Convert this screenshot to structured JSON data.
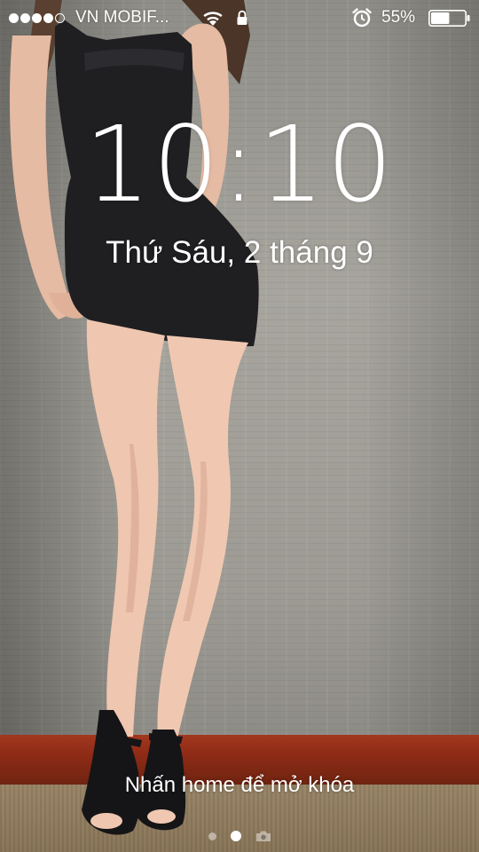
{
  "status_bar": {
    "signal_filled": 4,
    "signal_total": 5,
    "carrier": "VN MOBIF...",
    "wifi_icon": "wifi-icon",
    "lock_icon": "padlock-icon",
    "alarm_icon": "alarm-clock-icon",
    "battery_percent_label": "55%",
    "battery_level": 0.55
  },
  "lock_screen": {
    "time": "10:10",
    "date": "Thứ Sáu, 2 tháng 9",
    "unlock_hint": "Nhấn home để mở khóa",
    "page_indicator": {
      "pages": 2,
      "active_index": 1,
      "camera_icon": "camera-icon"
    }
  },
  "colors": {
    "text": "#ffffff",
    "baseboard": "#8e2b16"
  }
}
